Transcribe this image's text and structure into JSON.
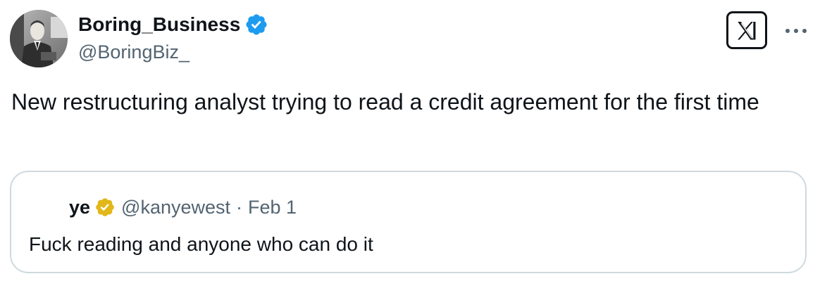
{
  "author": {
    "display_name": "Boring_Business",
    "handle": "@BoringBiz_",
    "avatar_icon": "vintage-portrait-avatar",
    "verified_icon": "verified-badge-blue-icon",
    "verified_color": "#1d9bf0"
  },
  "header": {
    "logo_icon": "x-logo-icon",
    "more_icon": "more-options-icon"
  },
  "tweet": {
    "text": "New restructuring analyst trying to read a credit agreement for the first time"
  },
  "quoted_tweet": {
    "display_name": "ye",
    "handle": "@kanyewest",
    "separator": "·",
    "date": "Feb 1",
    "text": "Fuck reading and anyone who can do it",
    "verified_icon": "verified-badge-gold-icon",
    "verified_color": "#e2b719"
  },
  "colors": {
    "text_primary": "#0f1419",
    "text_secondary": "#536471",
    "border": "#cfd9de"
  }
}
